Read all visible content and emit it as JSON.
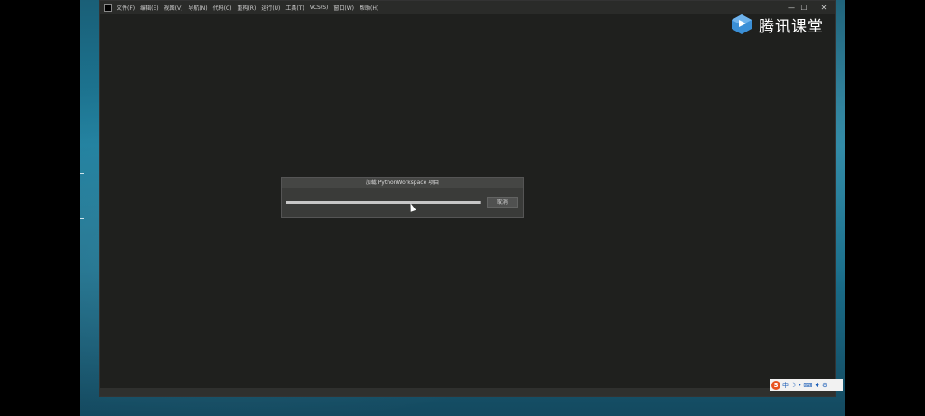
{
  "menubar": {
    "items": [
      "文件(F)",
      "编辑(E)",
      "视图(V)",
      "导航(N)",
      "代码(C)",
      "重构(R)",
      "运行(U)",
      "工具(T)",
      "VCS(S)",
      "窗口(W)",
      "帮助(H)"
    ]
  },
  "window_controls": {
    "minimize": "—",
    "maximize": "☐",
    "close": "✕"
  },
  "dialog": {
    "title": "加载 PythonWorkspace 项目",
    "cancel_label": "取消",
    "progress": 0.99
  },
  "watermark": {
    "text": "腾讯课堂"
  },
  "tray": {
    "ime_icon": "S",
    "ime_mode": "中",
    "icons": [
      "moon-icon",
      "dot-icon",
      "keyboard-icon",
      "shirt-icon",
      "gear-icon"
    ]
  }
}
